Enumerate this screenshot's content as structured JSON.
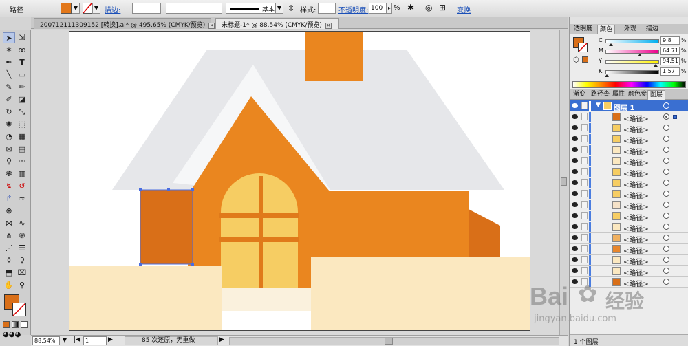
{
  "control_bar": {
    "object_type": "路径",
    "fill_color": "#e2771a",
    "stroke_label": "描边:",
    "stroke_profile": "基本",
    "style_label": "样式:",
    "opacity_label": "不透明度:",
    "opacity_value": "100",
    "opacity_unit": "%",
    "transform_label": "变换"
  },
  "tabs": [
    {
      "label": "200712111309152 [转换].ai* @ 495.65% (CMYK/预览)",
      "active": false
    },
    {
      "label": "未标题-1* @ 88.54% (CMYK/预览)",
      "active": true
    }
  ],
  "status_bar": {
    "zoom": "88.54%",
    "page": "1",
    "history": "85 次还原，无重做"
  },
  "color_panel": {
    "tabs": [
      "透明度",
      "颜色",
      "外观",
      "描边"
    ],
    "active_tab": "颜色",
    "fill_color": "#d96f18",
    "channels": [
      {
        "key": "C",
        "value": "9.8",
        "fraction": 0.098
      },
      {
        "key": "M",
        "value": "64.71",
        "fraction": 0.6471
      },
      {
        "key": "Y",
        "value": "94.51",
        "fraction": 0.9451
      },
      {
        "key": "K",
        "value": "1.57",
        "fraction": 0.0157
      }
    ],
    "unit": "%"
  },
  "layers_panel": {
    "tabs": [
      "渐变",
      "路径查",
      "属性",
      "颜色参",
      "图层"
    ],
    "active_tab": "图层",
    "layer_name": "图层 1",
    "paths": [
      {
        "name": "<路径>",
        "color": "#d96f18",
        "selected": true
      },
      {
        "name": "<路径>",
        "color": "#f6cd63",
        "selected": false
      },
      {
        "name": "<路径>",
        "color": "#f6cd63",
        "selected": false
      },
      {
        "name": "<路径>",
        "color": "#fbe8c0",
        "selected": false
      },
      {
        "name": "<路径>",
        "color": "#fbe8c0",
        "selected": false
      },
      {
        "name": "<路径>",
        "color": "#f6cd63",
        "selected": false
      },
      {
        "name": "<路径>",
        "color": "#f6cd63",
        "selected": false
      },
      {
        "name": "<路径>",
        "color": "#f6cd63",
        "selected": false
      },
      {
        "name": "<路径>",
        "color": "#f5e2c8",
        "selected": false
      },
      {
        "name": "<路径>",
        "color": "#f6cd63",
        "selected": false
      },
      {
        "name": "<路径>",
        "color": "#fbe8c0",
        "selected": false
      },
      {
        "name": "<路径>",
        "color": "#f0b060",
        "selected": false
      },
      {
        "name": "<路径>",
        "color": "#e8862c",
        "selected": false
      },
      {
        "name": "<路径>",
        "color": "#fbe8c0",
        "selected": false
      },
      {
        "name": "<路径>",
        "color": "#fbe8c0",
        "selected": false
      },
      {
        "name": "<路径>",
        "color": "#d96f18",
        "selected": false
      }
    ],
    "footer": "1 个图层"
  },
  "artwork": {
    "roof_outer": "#e6e7ea",
    "roof_inner": "#f6f7f8",
    "house_body": "#ea861f",
    "chimney": "#ea861f",
    "side_block": "#d96f18",
    "window_glass": "#f6cd63",
    "window_frame": "#e07a1a",
    "ground": "#fbe8c0",
    "ground_light": "#faf1dd",
    "selection": "#4a6de0"
  },
  "watermark": {
    "brand": "Bai",
    "brand_cn": "经验",
    "url": "jingyan.baidu.com"
  }
}
